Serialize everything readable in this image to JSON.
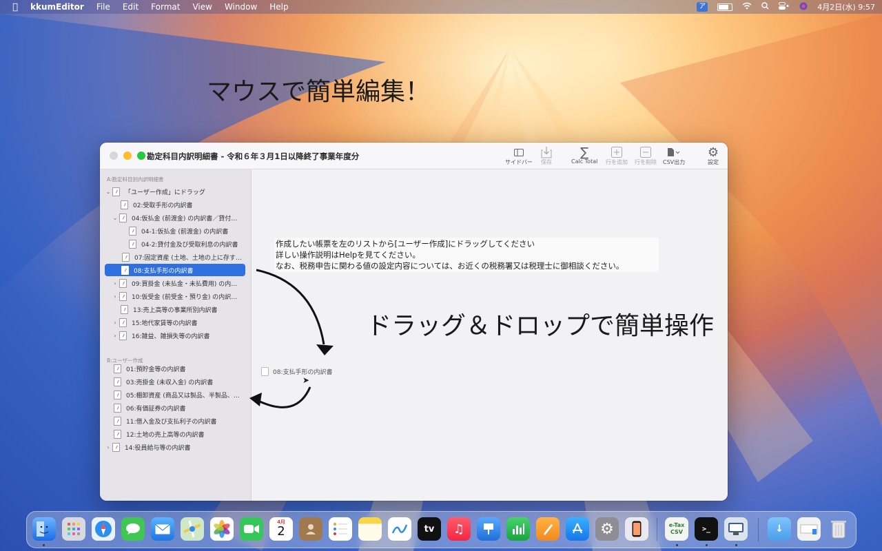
{
  "menubar": {
    "app_name": "kkumEditor",
    "menus": [
      "File",
      "Edit",
      "Format",
      "View",
      "Window",
      "Help"
    ],
    "ime_label": "ア",
    "datetime": "4月2日(水)  9:57"
  },
  "headline_top": "マウスで簡単編集！",
  "headline_mid": "ドラッグ＆ドロップで簡単操作",
  "window": {
    "title": "勘定科目内訳明細書 - 令和６年３月1日以降終了事業年度分",
    "toolbar": {
      "sidebar": "サイドバー",
      "save": "保存",
      "calc_total": "Calc Total",
      "add_row": "行を追加",
      "delete_row": "行を削除",
      "csv_export": "CSV出力",
      "settings": "設定"
    },
    "sidebar": {
      "section_a": "A:勘定科目別内訳明細書",
      "section_b": "B:ユーザー作成",
      "items_a": [
        "「ユーザー作成」にドラッグ",
        "02:受取手形の内訳書",
        "04:仮払金 (前渡金) の内訳書／貸付…",
        "04-1:仮払金 (前渡金) の内訳書",
        "04-2:貸付金及び受取利息の内訳書",
        "07:固定資産 (土地、土地の上に存す…",
        "08:支払手形の内訳書",
        "09:買掛金 (未払金・未払費用) の内…",
        "10:仮受金 (前受金・預り金) の内訳…",
        "13:売上高等の事業所別内訳書",
        "15:地代家賃等の内訳書",
        "16:雑益、雑損失等の内訳書"
      ],
      "items_b": [
        "01:預貯金等の内訳書",
        "03:売掛金 (未収入金) の内訳書",
        "05:棚卸資産 (商品又は製品、半製品、…",
        "06:有価証券の内訳書",
        "11:借入金及び支払利子の内訳書",
        "12:土地の売上高等の内訳書",
        "14:役員給与等の内訳書"
      ]
    },
    "content": {
      "message_lines": [
        "作成したい帳票を左のリストから[ユーザー作成]にドラッグしてください",
        "詳しい操作説明はHelpを見てください。",
        "なお、税務申告に関わる値の設定内容については、お近くの税務署又は税理士に御相談ください。"
      ],
      "dragging_item": "08:支払手形の内訳書"
    }
  },
  "dock": {
    "calendar_month": "4月",
    "calendar_day": "2",
    "tv_label": "tv",
    "etax_label": "e-Tax CSV"
  }
}
